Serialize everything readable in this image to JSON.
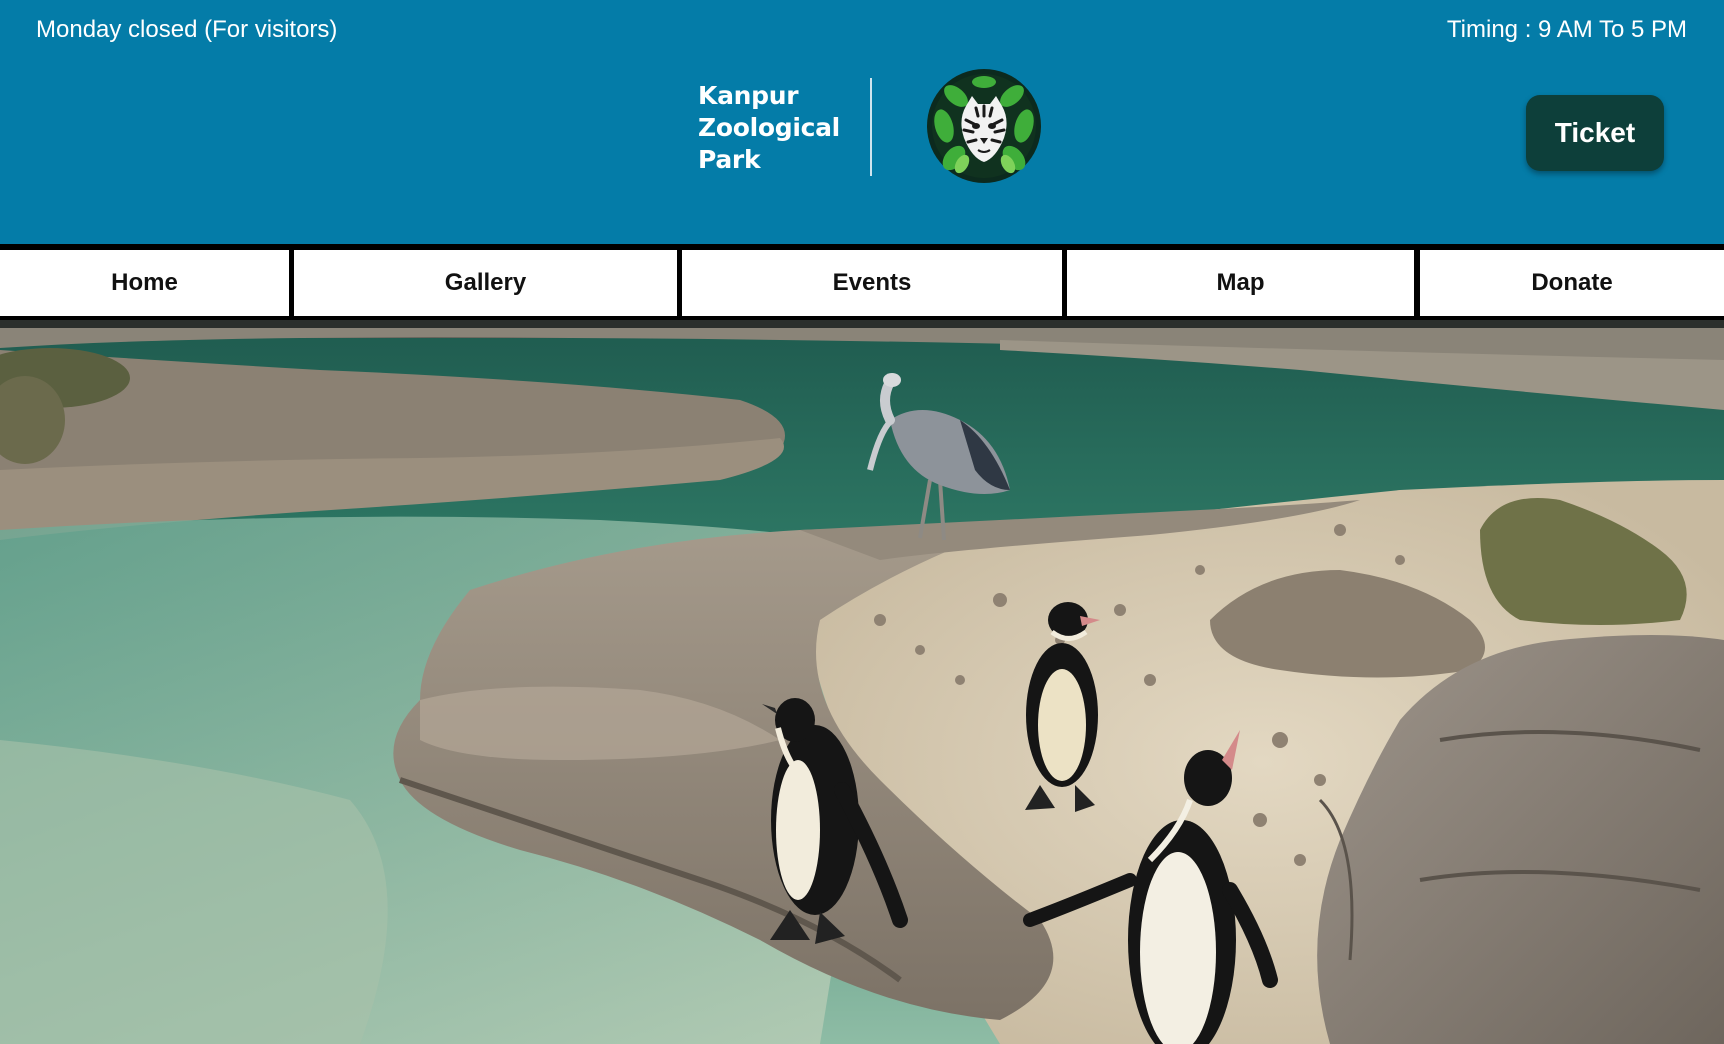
{
  "header": {
    "notice_left": "Monday closed (For visitors)",
    "notice_right": "Timing : 9 AM To 5 PM",
    "brand_line1": "Kanpur",
    "brand_line2": "Zoological",
    "brand_line3": "Park",
    "logo_icon": "tiger-leaf-logo",
    "ticket_label": "Ticket",
    "bg_color": "#047ca8",
    "button_color": "#0d3f3a"
  },
  "nav": {
    "items": [
      {
        "label": "Home"
      },
      {
        "label": "Gallery"
      },
      {
        "label": "Events"
      },
      {
        "label": "Map"
      },
      {
        "label": "Donate"
      }
    ]
  },
  "hero": {
    "image": "penguins-and-heron-enclosure-photo"
  }
}
